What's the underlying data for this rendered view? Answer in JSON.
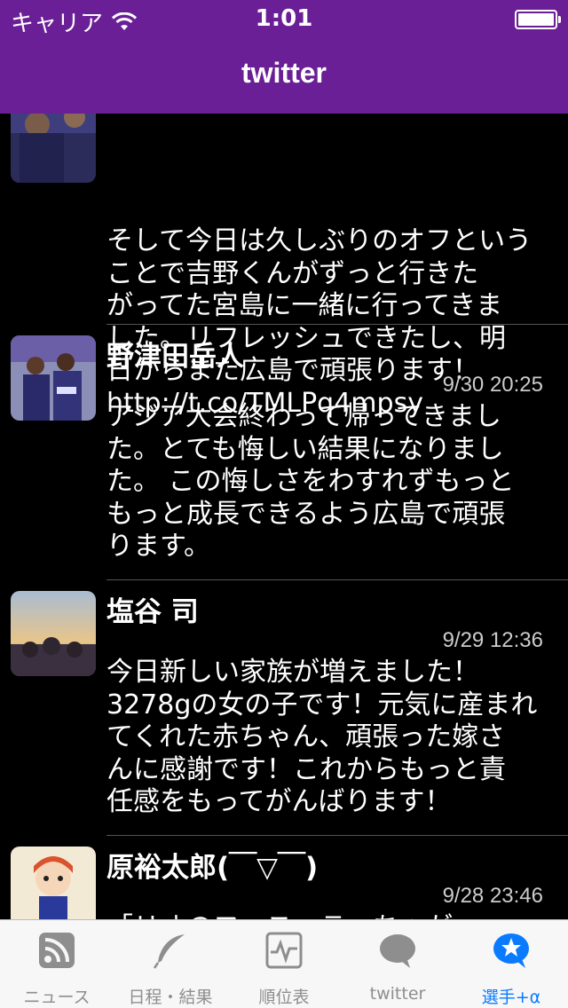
{
  "status_bar": {
    "carrier": "キャリア",
    "time": "1:01"
  },
  "nav": {
    "title": "twitter"
  },
  "tweets": [
    {
      "name": "",
      "date": "",
      "text": "そして今日は久しぶりのオフという\nことで吉野くんがずっと行きた\nがってた宮島に一緒に行ってきま\nした。リフレッシュできたし、明\n日からまた広島で頑張ります！\nhttp://t.co/TMLPq4mpsy"
    },
    {
      "name": "野津田岳人",
      "date": "9/30 20:25",
      "text": "アジア大会終わって帰ってきまし\nた。とても悔しい結果になりまし\nた。 この悔しさをわすれずもっと\nもっと成長できるよう広島で頑張\nります。"
    },
    {
      "name": "塩谷 司",
      "date": "9/29 12:36",
      "text": "今日新しい家族が増えました！\n3278gの女の子です！元気に産まれ\nてくれた赤ちゃん、頑張った嫁さ\nんに感謝です！これからもっと責\n任感をもってがんばります！"
    },
    {
      "name": "原裕太郎(￣▽￣)",
      "date": "9/28 23:46",
      "text": "「リオのフェス…ラ…ちゃが"
    }
  ],
  "tabs": [
    {
      "label": "ニュース",
      "icon": "rss-icon",
      "active": false
    },
    {
      "label": "日程・結果",
      "icon": "feather-icon",
      "active": false
    },
    {
      "label": "順位表",
      "icon": "chart-icon",
      "active": false
    },
    {
      "label": "twitter",
      "icon": "speech-bubble-icon",
      "active": false
    },
    {
      "label": "選手+α",
      "icon": "star-bubble-icon",
      "active": true
    }
  ],
  "colors": {
    "nav_bar": "#6a1f96",
    "background": "#000000",
    "tab_active": "#0a7bff",
    "tab_inactive": "#8e8e8e"
  }
}
